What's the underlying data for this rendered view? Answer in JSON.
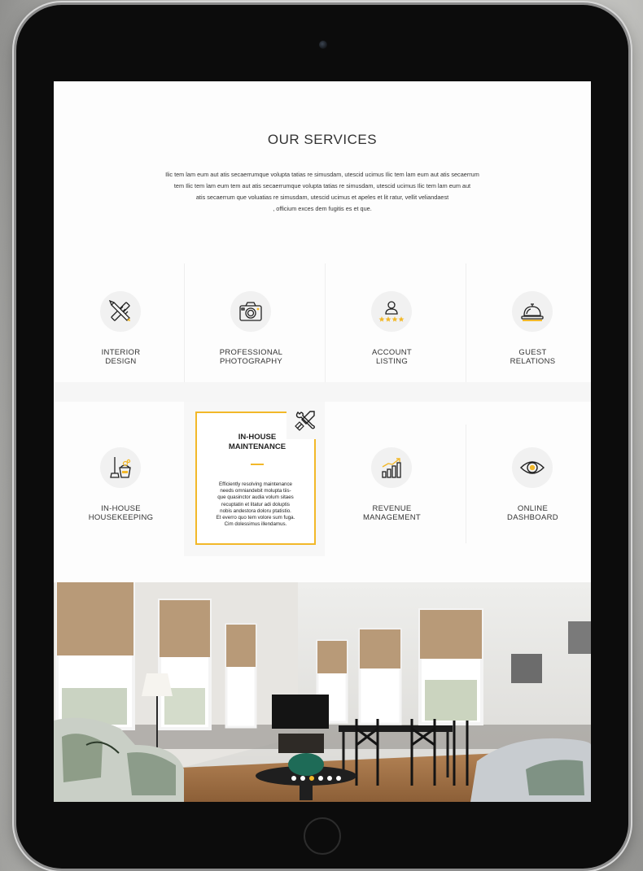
{
  "services": {
    "title": "OUR SERVICES",
    "description_lines": [
      "Ilic tem lam eum aut atis secaerrumque volupta tatias re simusdam, utescid ucimus Ilic tem lam eum aut atis secaerrum",
      "tem Ilic tem lam eum tem aut atis secaerrumque volupta tatias re simusdam, utescid ucimus Ilic tem lam eum aut",
      "atis secaerrum que voluatias re simusdam, utescid ucimus et apeles et lit ratur, vellit veliandaest",
      ", officium exces dem fugitis es et que."
    ],
    "items": [
      {
        "line1": "INTERIOR",
        "line2": "DESIGN",
        "icon": "pencil-ruler-icon"
      },
      {
        "line1": "PROFESSIONAL",
        "line2": "PHOTOGRAPHY",
        "icon": "camera-icon"
      },
      {
        "line1": "ACCOUNT",
        "line2": "LISTING",
        "icon": "user-stars-icon"
      },
      {
        "line1": "GUEST",
        "line2": "RELATIONS",
        "icon": "service-bell-icon"
      },
      {
        "line1": "IN-HOUSE",
        "line2": "HOUSEKEEPING",
        "icon": "mop-bucket-icon"
      },
      {
        "line1": "REVENUE",
        "line2": "MANAGEMENT",
        "icon": "growth-chart-icon"
      },
      {
        "line1": "ONLINE",
        "line2": "DASHBOARD",
        "icon": "eye-icon"
      }
    ],
    "highlight": {
      "title_line1": "IN-HOUSE",
      "title_line2": "MAINTENANCE",
      "icon": "wrench-screwdriver-icon",
      "text_lines": [
        "Efficiently resolving maintenance",
        "needs omniandebit molupta tiis-",
        "que quasinctor audia volum sitaes",
        "recuptatin et litatur adi doluptis",
        "nobis andestora doloru ptatistio.",
        "Et everro quo tem volore sum fuga.",
        "Cim dolessimus illendamus."
      ]
    }
  },
  "slider": {
    "dot_count": 6,
    "active_index": 2
  },
  "colors": {
    "accent": "#f2b829",
    "text": "#333333"
  }
}
